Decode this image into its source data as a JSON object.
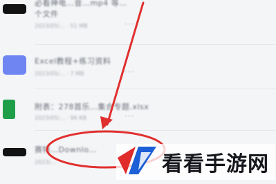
{
  "files": [
    {
      "title_line1": "必看神电…音…mp4 等…",
      "title_line2": "个文件",
      "meta": "2023/05/… · 51 MB",
      "thumb": "video"
    },
    {
      "title_line1": "Excel教程+练习资料",
      "meta": "2023/05/… · 7 MB",
      "thumb": "folder"
    },
    {
      "title_line1": "附表：278首乐…集合专题.xlsx",
      "meta": "2023/05/… · 96 KB",
      "thumb": "excel"
    },
    {
      "title_line1": "赛特…Downlo…",
      "meta": "2023/…",
      "thumb": "video"
    }
  ],
  "more_label": "···",
  "watermark": {
    "text": "看看手游网"
  },
  "colors": {
    "annotation": "#e0302e",
    "excel": "#1f9e4a",
    "folder": "#6f86f2",
    "video": "#111111"
  }
}
